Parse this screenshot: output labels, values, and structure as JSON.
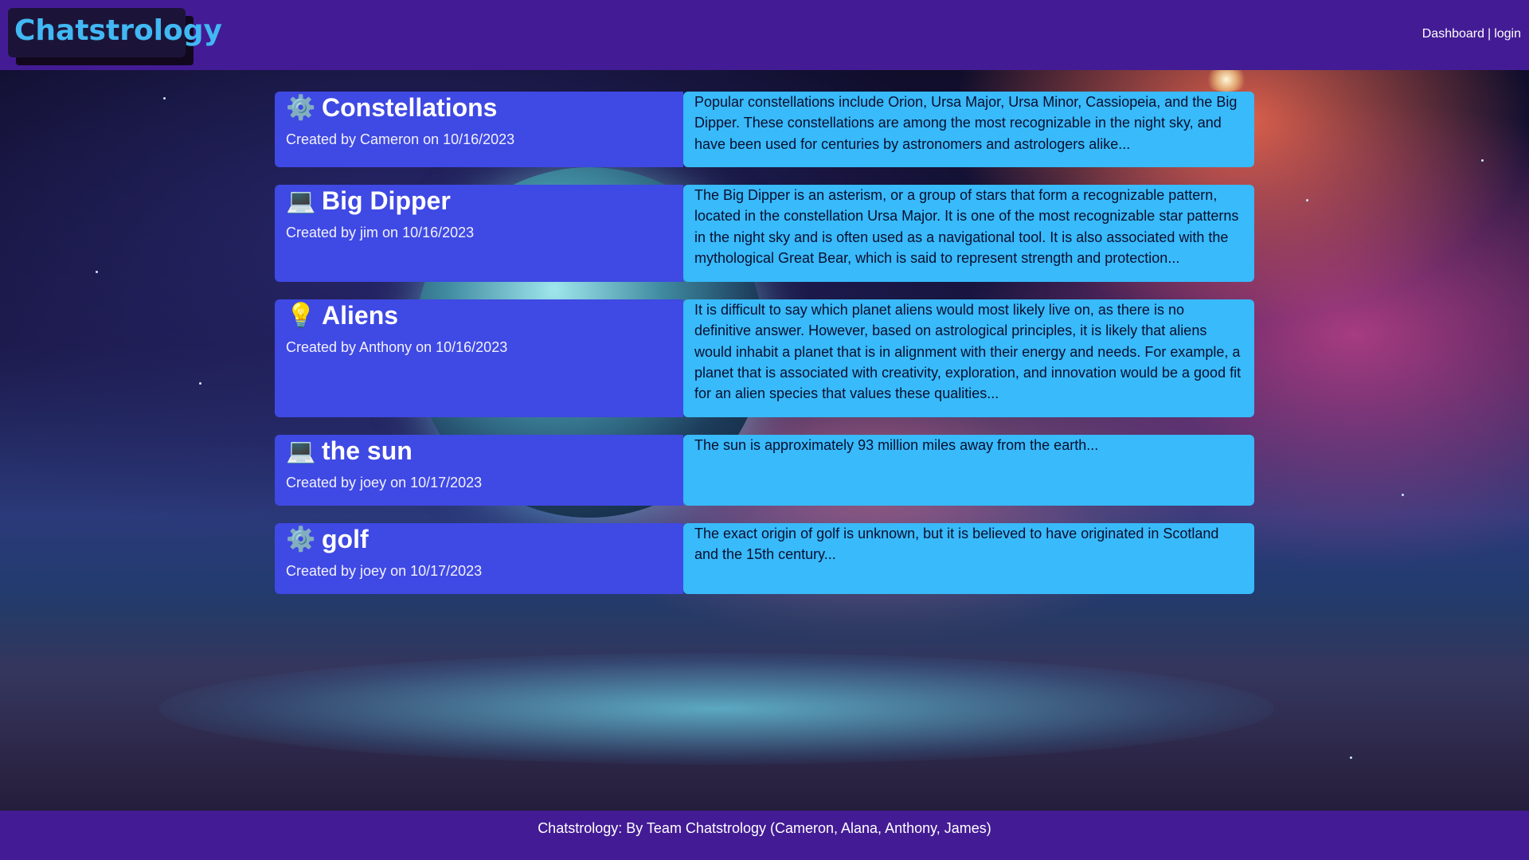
{
  "header": {
    "logo": "Chatstrology",
    "nav": {
      "dashboard": "Dashboard",
      "separator": "|",
      "login": "login"
    }
  },
  "posts": [
    {
      "icon": "⚙️",
      "icon_name": "gear-icon",
      "title": "Constellations",
      "meta": "Created by Cameron on 10/16/2023",
      "body": "Popular constellations include Orion, Ursa Major, Ursa Minor, Cassiopeia, and the Big Dipper. These constellations are among the most recognizable in the night sky, and have been used for centuries by astronomers and astrologers alike..."
    },
    {
      "icon": "💻",
      "icon_name": "laptop-icon",
      "title": "Big Dipper",
      "meta": "Created by jim on 10/16/2023",
      "body": "The Big Dipper is an asterism, or a group of stars that form a recognizable pattern, located in the constellation Ursa Major. It is one of the most recognizable star patterns in the night sky and is often used as a navigational tool. It is also associated with the mythological Great Bear, which is said to represent strength and protection..."
    },
    {
      "icon": "💡",
      "icon_name": "lightbulb-icon",
      "title": "Aliens",
      "meta": "Created by Anthony on 10/16/2023",
      "body": "It is difficult to say which planet aliens would most likely live on, as there is no definitive answer. However, based on astrological principles, it is likely that aliens would inhabit a planet that is in alignment with their energy and needs. For example, a planet that is associated with creativity, exploration, and innovation would be a good fit for an alien species that values these qualities..."
    },
    {
      "icon": "💻",
      "icon_name": "laptop-icon",
      "title": "the sun",
      "meta": "Created by joey on 10/17/2023",
      "body": "The sun is approximately 93 million miles away from the earth..."
    },
    {
      "icon": "⚙️",
      "icon_name": "gear-icon",
      "title": "golf",
      "meta": "Created by joey on 10/17/2023",
      "body": "The exact origin of golf is unknown, but it is believed to have originated in Scotland and the 15th century..."
    }
  ],
  "footer": {
    "text": "Chatstrology: By Team Chatstrology (Cameron, Alana, Anthony, James)"
  },
  "colors": {
    "header_bg": "#431b95",
    "logo_text": "#41b8f3",
    "post_left_bg": "#3f49e3",
    "post_right_bg": "#38bafb"
  }
}
